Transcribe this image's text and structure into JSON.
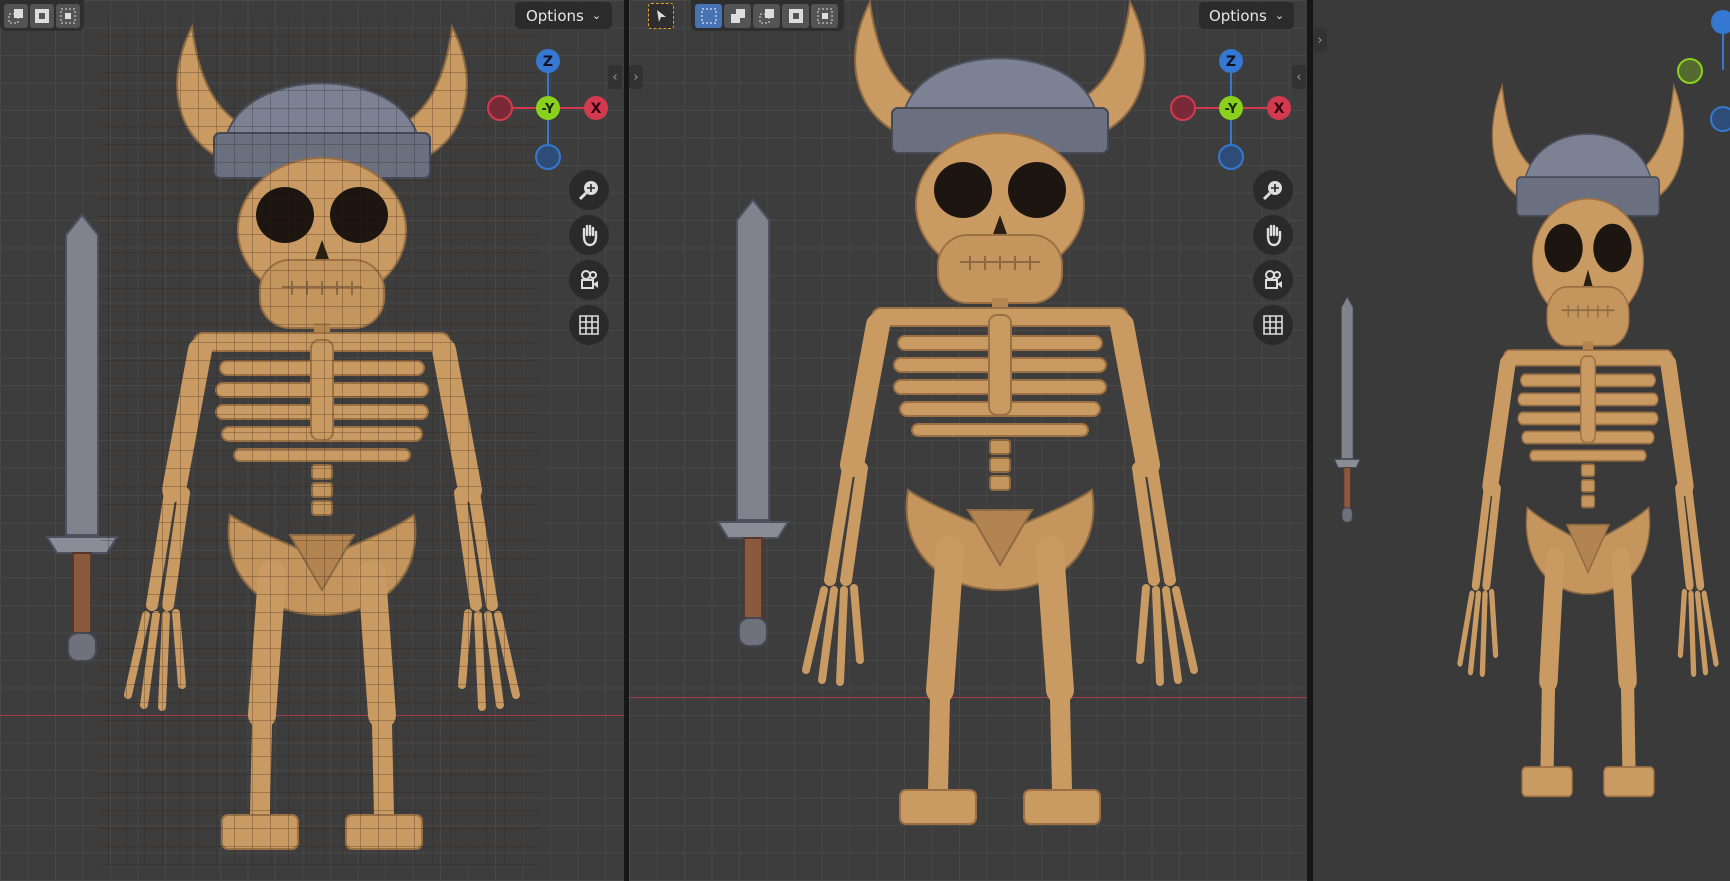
{
  "viewports": [
    {
      "name": "wireframe-front",
      "options_label": "Options",
      "gizmo": {
        "z": "Z",
        "y": "-Y",
        "x": "X"
      }
    },
    {
      "name": "shaded-front",
      "options_label": "Options",
      "gizmo": {
        "z": "Z",
        "y": "-Y",
        "x": "X"
      }
    },
    {
      "name": "shaded-perspective"
    }
  ],
  "icons": {
    "nav": [
      "zoom-icon",
      "hand-pan-icon",
      "camera-icon",
      "grid-ortho-icon"
    ],
    "modes": [
      "select-box-icon",
      "mode-new-icon",
      "mode-extend-icon",
      "mode-subtract-icon",
      "mode-intersect-icon"
    ]
  },
  "colors": {
    "bone": "#c99a62",
    "bone_dark": "#9c7045",
    "helmet": "#7c8293",
    "helmet_band": "#6b7080",
    "axis_x": "#d43a4f",
    "axis_y": "#8ad11d",
    "axis_z": "#3478d2",
    "active": "#4772b3",
    "select_outline": "#e8a030"
  }
}
